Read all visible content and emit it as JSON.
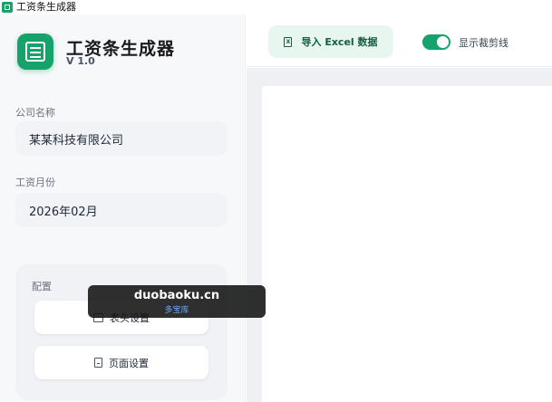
{
  "window": {
    "title": "工资条生成器"
  },
  "app": {
    "name": "工资条生成器",
    "version": "V 1.0"
  },
  "company": {
    "label": "公司名称",
    "value": "某某科技有限公司"
  },
  "month": {
    "label": "工资月份",
    "value": "2026年02月"
  },
  "config": {
    "label": "配置",
    "buttons": [
      {
        "label": "表头设置",
        "icon": "table-icon"
      },
      {
        "label": "页面设置",
        "icon": "page-icon"
      }
    ]
  },
  "toolbar": {
    "import_label": "导入 Excel 数据",
    "toggle_label": "显示裁剪线",
    "toggle_on": true
  },
  "watermark": {
    "main": "duobaoku.cn",
    "sub": "多宝库"
  },
  "colors": {
    "accent": "#16a36b",
    "accent_light": "#e8f6f0"
  }
}
